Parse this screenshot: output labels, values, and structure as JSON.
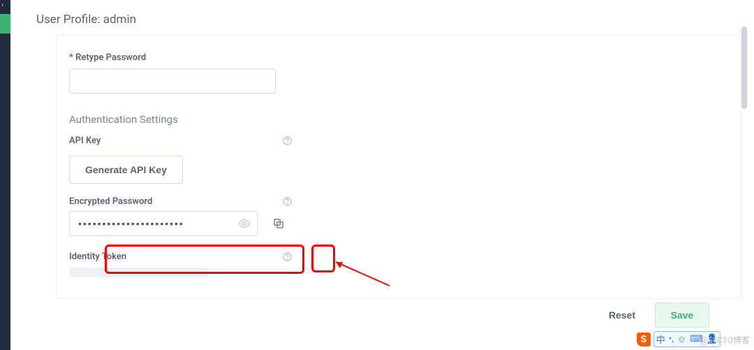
{
  "page": {
    "title": "User Profile: admin"
  },
  "fields": {
    "retype_password": {
      "label": "* Retype Password",
      "value": ""
    },
    "auth_section": "Authentication Settings",
    "api_key": {
      "label": "API Key",
      "generate_label": "Generate API Key"
    },
    "encrypted_password": {
      "label": "Encrypted Password",
      "value": "••••••••••••••••••••••"
    },
    "identity_token": {
      "label": "Identity Token"
    }
  },
  "footer": {
    "reset": "Reset",
    "save": "Save"
  },
  "icons": {
    "help": "question-circle-icon",
    "eye": "eye-icon",
    "copy": "copy-icon",
    "caret_left": "‹"
  },
  "ime": {
    "brand": "S",
    "lang": "中",
    "punct": "•,",
    "smile": "☺",
    "keyboard": "⌨",
    "user": "👤"
  },
  "watermark": "@51CTO博客"
}
